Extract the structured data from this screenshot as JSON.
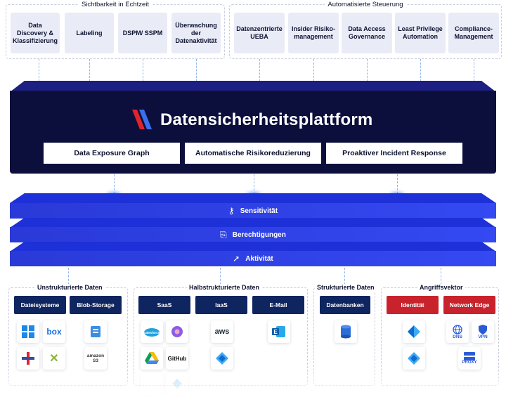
{
  "visibility": {
    "title": "Sichtbarkeit in Echtzeit",
    "items": [
      "Data Discovery & Klassifizierung",
      "Labeling",
      "DSPM/ SSPM",
      "Überwachung der Datenaktivität"
    ]
  },
  "control": {
    "title": "Automatisierte Steuerung",
    "items": [
      "Datenzentrierte UEBA",
      "Insider Risiko- management",
      "Data Access Governance",
      "Least Privilege Automation",
      "Compliance- Management"
    ]
  },
  "platform": {
    "title": "Datensicherheitsplattform",
    "features": [
      "Data Exposure Graph",
      "Automatische Risikoreduzierung",
      "Proaktiver Incident Response"
    ]
  },
  "layers": [
    "Sensitivität",
    "Berechtigungen",
    "Aktivität"
  ],
  "sources": {
    "unstructured": {
      "title": "Unstrukturierte Daten",
      "categories": [
        "Dateisysteme",
        "Blob-Storage"
      ]
    },
    "semistructured": {
      "title": "Halbstrukturierte Daten",
      "categories": [
        "SaaS",
        "IaaS",
        "E-Mail"
      ]
    },
    "structured": {
      "title": "Strukturierte Daten",
      "categories": [
        "Datenbanken"
      ]
    },
    "attack": {
      "title": "Angriffsvektor",
      "categories": [
        "Identität",
        "Network Edge"
      ]
    }
  },
  "tiles": {
    "box": "box",
    "amazon": "amazon",
    "s3": "S3",
    "salesforce": "salesforce",
    "github": "GitHub",
    "aws": "aws",
    "exchange": "E",
    "dns": "DNS",
    "vpn": "VPN",
    "proxy": "PROXY"
  },
  "icons": {
    "sensitivity": "key-icon",
    "permissions": "document-lock-icon",
    "activity": "cursor-click-icon"
  },
  "colors": {
    "platform": "#0c0f3c",
    "layer": "#3449f2",
    "category": "#0f2560",
    "attack": "#c8232c",
    "capability_box": "#e9ecf7"
  }
}
